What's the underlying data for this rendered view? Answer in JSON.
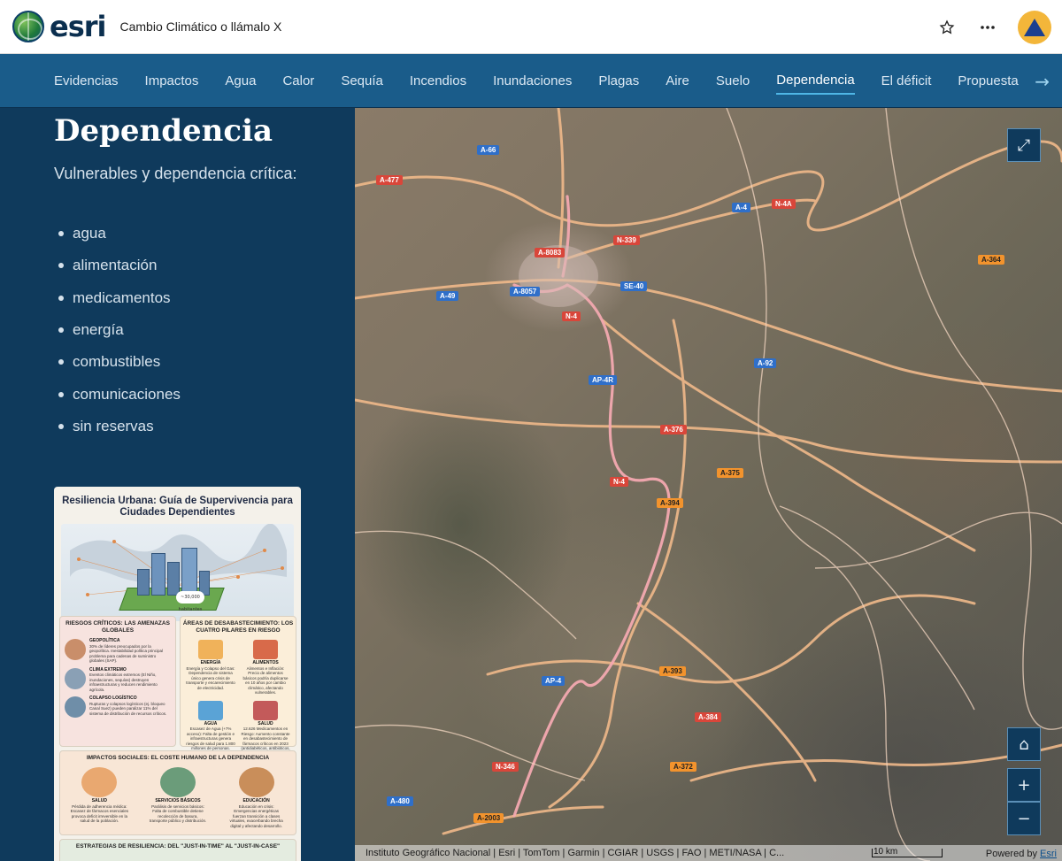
{
  "header": {
    "logo_text": "esri",
    "title": "Cambio Climático o llámalo X",
    "icons": [
      "star-icon",
      "more-icon",
      "warning-avatar-icon"
    ]
  },
  "nav": {
    "items": [
      "Evidencias",
      "Impactos",
      "Agua",
      "Calor",
      "Sequía",
      "Incendios",
      "Inundaciones",
      "Plagas",
      "Aire",
      "Suelo",
      "Dependencia",
      "El déficit",
      "Propuesta"
    ],
    "active": "Dependencia",
    "next_arrow": "→"
  },
  "section": {
    "title": "Dependencia",
    "subtitle": "Vulnerables y dependencia crítica:",
    "bullets": [
      "agua",
      "alimentación",
      "medicamentos",
      "energía",
      "combustibles",
      "comunicaciones",
      "sin reservas"
    ]
  },
  "infographic": {
    "title": "Resiliencia Urbana: Guía de Supervivencia para Ciudades Dependientes",
    "hero_caption": "~30,000 habitantes",
    "riesgos": {
      "heading": "RIESGOS CRÍTICOS: LAS AMENAZAS GLOBALES",
      "items": [
        {
          "label": "GEOPOLÍTICA",
          "text": "30% de líderes preocupados por la geopolítica. Inestabilidad política principal problema para cadenas de suministro globales (SAP)."
        },
        {
          "label": "CLIMA EXTREMO",
          "text": "Eventos climáticos extremos (El Niño, inundaciones, sequías) destruyen infraestructuras y reducen rendimiento agrícola."
        },
        {
          "label": "COLAPSO LOGÍSTICO",
          "text": "Rupturas y colapsos logísticos (ej. bloqueo Canal Suez) pueden paralizar 11% del sistema de distribución de recursos críticos."
        }
      ]
    },
    "areas": {
      "heading": "ÁREAS DE DESABASTECIMIENTO: LOS CUATRO PILARES EN RIESGO",
      "items": [
        {
          "label": "ENERGÍA",
          "text": "Energía y Colapso del Gas: Dependencia de sistema único genera crisis de transporte y encarecimiento de electricidad."
        },
        {
          "label": "ALIMENTOS",
          "text": "Alimentos e Inflación: Precio de alimentos básicos podría duplicarse en 10 años por cambio climático, afectando vulnerables."
        },
        {
          "label": "AGUA",
          "text": "Escasez de Agua (+7% acceso): Falta de gestión e infraestructuras genera riesgos de salud para 1.800 millones de personas."
        },
        {
          "label": "SALUD",
          "text": "12.626 Medicamentos en Riesgo: Aumento constante en desabastecimiento de fármacos críticos en 2023 (antidiabéticos, antibióticos, antidepresivos)."
        }
      ]
    },
    "impactos": {
      "heading": "IMPACTOS SOCIALES: EL COSTE HUMANO DE LA DEPENDENCIA",
      "items": [
        {
          "label": "SALUD",
          "text": "Pérdida de adherencia médica: Escasez de fármacos esenciales provoca deficit irreversible en la salud de la población."
        },
        {
          "label": "SERVICIOS BÁSICOS",
          "text": "Parálisis de servicios básicos: Falta de combustible detiene recolección de basura, transporte público y distribución."
        },
        {
          "label": "EDUCACIÓN",
          "text": "Educación en crisis: Emergencias energéticas fuerzan transición a clases virtuales, exacerbando brecha digital y afectando desarrollo."
        }
      ]
    },
    "estrategias": {
      "heading": "ESTRATEGIAS DE RESILIENCIA: DEL \"JUST-IN-TIME\" AL \"JUST-IN-CASE\""
    }
  },
  "map": {
    "road_labels": [
      {
        "text": "A-66",
        "style": "blue"
      },
      {
        "text": "A-477",
        "style": "red"
      },
      {
        "text": "A-4",
        "style": "blue"
      },
      {
        "text": "N-4A",
        "style": "red"
      },
      {
        "text": "N-339",
        "style": "red"
      },
      {
        "text": "A-8083",
        "style": "red"
      },
      {
        "text": "A-364",
        "style": "orange"
      },
      {
        "text": "A-8057",
        "style": "blue"
      },
      {
        "text": "SE-40",
        "style": "blue"
      },
      {
        "text": "A-49",
        "style": "blue"
      },
      {
        "text": "N-4",
        "style": "red"
      },
      {
        "text": "A-92",
        "style": "blue"
      },
      {
        "text": "AP-4R",
        "style": "blue"
      },
      {
        "text": "A-376",
        "style": "red"
      },
      {
        "text": "A-375",
        "style": "orange"
      },
      {
        "text": "N-4",
        "style": "red"
      },
      {
        "text": "A-394",
        "style": "orange"
      },
      {
        "text": "AP-4",
        "style": "blue"
      },
      {
        "text": "A-393",
        "style": "orange"
      },
      {
        "text": "A-384",
        "style": "red"
      },
      {
        "text": "N-346",
        "style": "red"
      },
      {
        "text": "A-372",
        "style": "orange"
      },
      {
        "text": "A-480",
        "style": "blue"
      },
      {
        "text": "A-2003",
        "style": "orange"
      }
    ],
    "attribution": "Instituto Geográfico Nacional | Esri | TomTom | Garmin | CGIAR | USGS | FAO | METI/NASA | C...",
    "scale_label": "10 km",
    "powered_by": "Powered by",
    "powered_link": "Esri",
    "controls": {
      "expand": "⤢",
      "home": "⌂",
      "zoom_in": "+",
      "zoom_out": "−"
    }
  }
}
